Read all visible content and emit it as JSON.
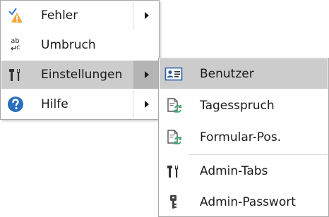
{
  "main_menu": {
    "items": [
      {
        "label": "Fehler",
        "icon": "error-check-icon",
        "has_submenu": true
      },
      {
        "label": "Umbruch",
        "icon": "abc-wrap-icon",
        "has_submenu": false
      },
      {
        "label": "Einstellungen",
        "icon": "tools-icon",
        "has_submenu": true
      },
      {
        "label": "Hilfe",
        "icon": "help-icon",
        "has_submenu": true
      }
    ]
  },
  "sub_menu": {
    "items": [
      {
        "label": "Benutzer",
        "icon": "user-card-icon"
      },
      {
        "label": "Tagesspruch",
        "icon": "document-refresh-icon"
      },
      {
        "label": "Formular-Pos.",
        "icon": "document-refresh-icon"
      },
      {
        "label": "Admin-Tabs",
        "icon": "tools-icon"
      },
      {
        "label": "Admin-Passwort",
        "icon": "key-icon"
      }
    ]
  },
  "abc_icon_text": {
    "top": "ab",
    "bottom": "c"
  },
  "colors": {
    "highlight": "#cccccc",
    "arrow_zone": "#b4b4b4",
    "help_blue": "#2a6fbf",
    "warning_orange": "#f2a63a",
    "check_blue": "#3a7fd0",
    "refresh_green": "#3aa66a"
  }
}
